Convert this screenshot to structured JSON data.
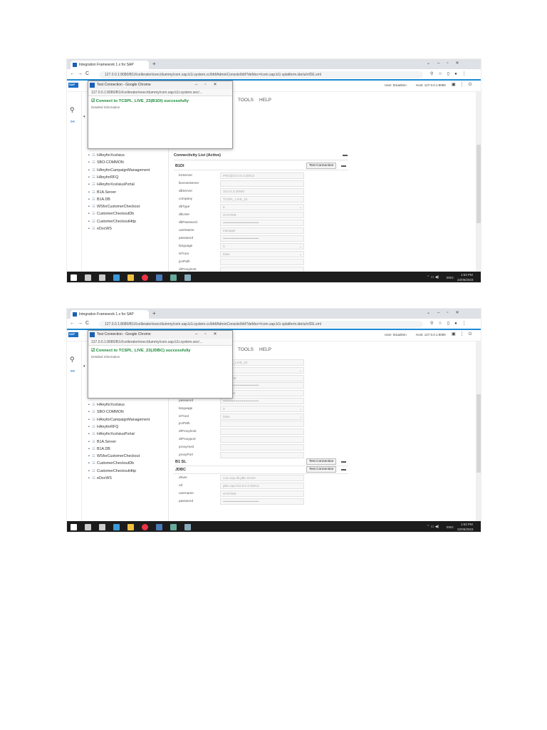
{
  "shots": [
    {
      "browser": {
        "tab_title": "Integration Framework 1.x for SAP",
        "url": "127.0.0.1:8080/B1iXcellerator/exec/dummy/com.sap.b1i.system.cc/bfd/AdminConsole/bfd?defdoc=/com.sap.b1i.vplatform.ide/ui/vIDE.xml"
      },
      "sap_header": {
        "user": "User: B1iadmin",
        "host": "Host: 127.0.0.1:8080"
      },
      "menu": [
        "TOOLS",
        "HELP"
      ],
      "popup": {
        "title": "Test Connection - Google Chrome",
        "url": "127.0.0.1:8080/B1iXcellerator/exec/dummy/com.sap.b1i.system.sec/...",
        "message": "Connect to TCSPL_LIVE_23(B1DI) successfully",
        "detail": "Detailed Information"
      },
      "tree": [
        "HAnyforXcelsius",
        "SBO-COMMON",
        "HAnyforCampaignManagement",
        "HAnyforRFQ",
        "HAnyforXcelsiusPortal",
        "B1A.Server",
        "B1A.DB",
        "WSforCustomerCheckout",
        "CustomerCheckoutDb",
        "CustomerCheckoutHttp",
        "eDocWS"
      ],
      "sections": [
        {
          "type": "header",
          "label": "Connectivity List (Active)"
        },
        {
          "type": "group",
          "label": "B1DI",
          "button": "Test Connection"
        },
        {
          "type": "field",
          "label": "b1Server",
          "value": "PRD@10.0.0.4:30013"
        },
        {
          "type": "field",
          "label": "licenseServer",
          "value": ""
        },
        {
          "type": "field",
          "label": "dbServer",
          "value": "10.0.0.4:30000"
        },
        {
          "type": "field",
          "label": "company",
          "value": "TCSPL_LIVE_23"
        },
        {
          "type": "select",
          "label": "dbType",
          "value": "9"
        },
        {
          "type": "field",
          "label": "dbUser",
          "value": "SYSTEM"
        },
        {
          "type": "field",
          "label": "dbPassword",
          "value": "••••••••••••••••••••••••••••••••"
        },
        {
          "type": "field",
          "label": "userName",
          "value": "manager"
        },
        {
          "type": "field",
          "label": "password",
          "value": "••••••••••••••••••••••••••••••••"
        },
        {
          "type": "select",
          "label": "language",
          "value": "3"
        },
        {
          "type": "select",
          "label": "isTrust",
          "value": "false"
        },
        {
          "type": "field",
          "label": "jcoPath",
          "value": ""
        },
        {
          "type": "field",
          "label": "diProxyhost",
          "value": ""
        }
      ],
      "clock": {
        "time": "1:53 PM",
        "date": "22/06/2023",
        "lang": "ENG"
      }
    },
    {
      "browser": {
        "tab_title": "Integration Framework 1.x for SAP",
        "url": "127.0.0.1:8080/B1iXcellerator/exec/dummy/com.sap.b1i.system.cc/bfd/AdminConsole/bfd?defdoc=/com.sap.b1i.vplatform.ide/ui/vIDE.xml"
      },
      "sap_header": {
        "user": "User: B1iadmin",
        "host": "Host: 127.0.0.1:8080"
      },
      "menu": [
        "TOOLS",
        "HELP"
      ],
      "popup": {
        "title": "Test Connection - Google Chrome",
        "url": "127.0.0.1:8080/B1iXcellerator/exec/dummy/com.sap.b1i.system.sec/...",
        "message": "Connect to TCSPL_LIVE_23(JDBC) successfully",
        "detail": "Detailed Information"
      },
      "tree": [
        "HAnyforXcelsius",
        "SBO-COMMON",
        "HAnyforCampaignManagement",
        "HAnyforRFQ",
        "HAnyforXcelsiusPortal",
        "B1A.Server",
        "B1A.DB",
        "WSforCustomerCheckout",
        "CustomerCheckoutDb",
        "CustomerCheckoutHttp",
        "eDocWS"
      ],
      "sections": [
        {
          "type": "field",
          "label": "company",
          "value": "TCSPL_LIVE_23"
        },
        {
          "type": "select",
          "label": "dbType",
          "value": "9"
        },
        {
          "type": "field",
          "label": "dbUser",
          "value": "SYSTEM"
        },
        {
          "type": "field",
          "label": "dbPassword",
          "value": "••••••••••••••••••••••••••••••••"
        },
        {
          "type": "field",
          "label": "userName",
          "value": "manager"
        },
        {
          "type": "field",
          "label": "password",
          "value": "••••••••••••••••••••••••••••••••"
        },
        {
          "type": "select",
          "label": "language",
          "value": "3"
        },
        {
          "type": "select",
          "label": "isTrust",
          "value": "false"
        },
        {
          "type": "field",
          "label": "jcoPath",
          "value": ""
        },
        {
          "type": "field",
          "label": "diProxyhost",
          "value": ""
        },
        {
          "type": "field",
          "label": "diProxyport",
          "value": ""
        },
        {
          "type": "field",
          "label": "proxyHost",
          "value": ""
        },
        {
          "type": "field",
          "label": "proxyPort",
          "value": ""
        },
        {
          "type": "group",
          "label": "B1 SL",
          "button": "Test Connection"
        },
        {
          "type": "group",
          "label": "JDBC",
          "button": "Test Connection"
        },
        {
          "type": "field",
          "label": "driver",
          "value": "com.sap.db.jdbc.Driver"
        },
        {
          "type": "field",
          "label": "url",
          "value": "jdbc:sap://10.0.0.4:30013"
        },
        {
          "type": "field",
          "label": "username",
          "value": "SYSTEM"
        },
        {
          "type": "field",
          "label": "password",
          "value": "••••••••••••••••••••••••••••••••"
        }
      ],
      "clock": {
        "time": "1:53 PM",
        "date": "22/06/2023",
        "lang": "ENG"
      }
    }
  ]
}
